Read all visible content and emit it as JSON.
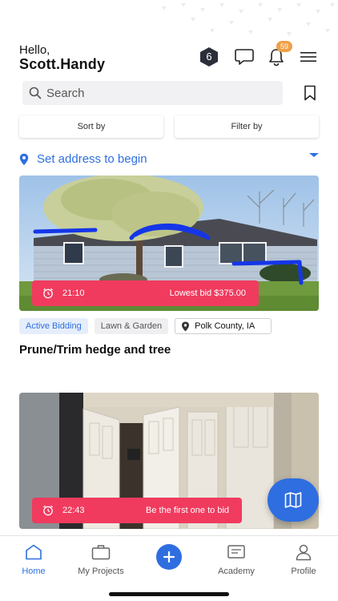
{
  "header": {
    "greeting": "Hello,",
    "username": "Scott.Handy",
    "level_badge": "6",
    "notification_count": "59"
  },
  "search": {
    "placeholder": "Search"
  },
  "filters": {
    "sort_label": "Sort by",
    "filter_label": "Filter by"
  },
  "address": {
    "label": "Set address to begin"
  },
  "jobs": [
    {
      "timer": "21:10",
      "bid_text": "Lowest bid  $375.00",
      "status": "Active Bidding",
      "category": "Lawn & Garden",
      "location": "Polk County, IA",
      "title": "Prune/Trim hedge and tree"
    },
    {
      "timer": "22:43",
      "bid_text": "Be the first one to bid"
    }
  ],
  "tabs": [
    {
      "label": "Home",
      "icon": "home-icon",
      "active": true
    },
    {
      "label": "My Projects",
      "icon": "briefcase-icon"
    },
    {
      "label": "",
      "icon": "plus-icon"
    },
    {
      "label": "Academy",
      "icon": "academy-icon"
    },
    {
      "label": "Profile",
      "icon": "profile-icon"
    }
  ],
  "colors": {
    "accent": "#2f6ee0",
    "timer_bar": "#f03b5e",
    "notification_badge": "#f0a046",
    "hex_badge": "#2c2f3a"
  }
}
